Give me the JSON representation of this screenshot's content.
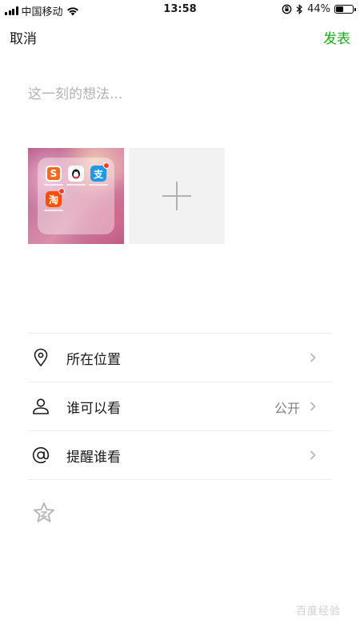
{
  "status_bar": {
    "carrier": "中国移动",
    "time": "13:58",
    "battery": "44%",
    "battery_level": 0.44
  },
  "nav": {
    "cancel": "取消",
    "publish": "发表",
    "publish_color": "#1aad19"
  },
  "post": {
    "placeholder": "这一刻的想法..."
  },
  "photos": {
    "thumbnail_icon": "app-folder-screenshot",
    "add_icon": "plus-icon"
  },
  "options": [
    {
      "icon": "location-pin-icon",
      "label": "所在位置",
      "value": ""
    },
    {
      "icon": "person-icon",
      "label": "谁可以看",
      "value": "公开"
    },
    {
      "icon": "at-sign-icon",
      "label": "提醒谁看",
      "value": ""
    }
  ],
  "watermark": "百度经验"
}
